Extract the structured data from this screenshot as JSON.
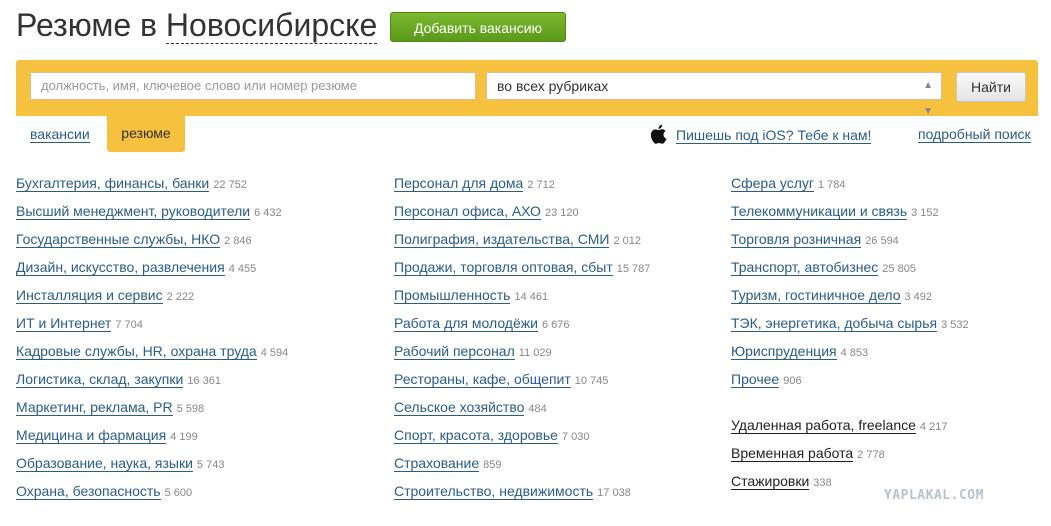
{
  "header": {
    "title_prefix": "Резюме в",
    "city": "Новосибирске",
    "add_button": "Добавить вакансию"
  },
  "search": {
    "placeholder": "должность, имя, ключевое слово или номер резюме",
    "rubric_value": "во всех рубриках",
    "find_button": "Найти"
  },
  "tabs": {
    "vacancies": "вакансии",
    "resumes": "резюме"
  },
  "links": {
    "ios": "Пишешь под iOS? Тебе к нам!",
    "advanced": "подробный поиск"
  },
  "categories": [
    [
      {
        "name": "Бухгалтерия, финансы, банки",
        "count": "22 752"
      },
      {
        "name": "Высший менеджмент, руководители",
        "count": "6 432"
      },
      {
        "name": "Государственные службы, НКО",
        "count": "2 846"
      },
      {
        "name": "Дизайн, искусство, развлечения",
        "count": "4 455"
      },
      {
        "name": "Инсталляция и сервис",
        "count": "2 222"
      },
      {
        "name": "ИТ и Интернет",
        "count": "7 704"
      },
      {
        "name": "Кадровые службы, HR, охрана труда",
        "count": "4 594"
      },
      {
        "name": "Логистика, склад, закупки",
        "count": "16 361"
      },
      {
        "name": "Маркетинг, реклама, PR",
        "count": "5 598"
      },
      {
        "name": "Медицина и фармация",
        "count": "4 199"
      },
      {
        "name": "Образование, наука, языки",
        "count": "5 743"
      },
      {
        "name": "Охрана, безопасность",
        "count": "5 600"
      }
    ],
    [
      {
        "name": "Персонал для дома",
        "count": "2 712"
      },
      {
        "name": "Персонал офиса, АХО",
        "count": "23 120"
      },
      {
        "name": "Полиграфия, издательства, СМИ",
        "count": "2 012"
      },
      {
        "name": "Продажи, торговля оптовая, сбыт",
        "count": "15 787"
      },
      {
        "name": "Промышленность",
        "count": "14 461"
      },
      {
        "name": "Работа для молодёжи",
        "count": "6 676"
      },
      {
        "name": "Рабочий персонал",
        "count": "11 029"
      },
      {
        "name": "Рестораны, кафе, общепит",
        "count": "10 745"
      },
      {
        "name": "Сельское хозяйство",
        "count": "484"
      },
      {
        "name": "Спорт, красота, здоровье",
        "count": "7 030"
      },
      {
        "name": "Страхование",
        "count": "859"
      },
      {
        "name": "Строительство, недвижимость",
        "count": "17 038"
      }
    ],
    [
      {
        "name": "Сфера услуг",
        "count": "1 784"
      },
      {
        "name": "Телекоммуникации и связь",
        "count": "3 152"
      },
      {
        "name": "Торговля розничная",
        "count": "26 594"
      },
      {
        "name": "Транспорт, автобизнес",
        "count": "25 805"
      },
      {
        "name": "Туризм, гостиничное дело",
        "count": "3 492"
      },
      {
        "name": "ТЭК, энергетика, добыча сырья",
        "count": "3 532"
      },
      {
        "name": "Юриспруденция",
        "count": "4 853"
      },
      {
        "name": "Прочее",
        "count": "906"
      }
    ]
  ],
  "extra": [
    {
      "name": "Удаленная работа, freelance",
      "count": "4 217"
    },
    {
      "name": "Временная работа",
      "count": "2 778"
    },
    {
      "name": "Стажировки",
      "count": "338"
    }
  ],
  "watermark": "YAPLAKAL.COM",
  "colors": {
    "accent_yellow": "#f5c13f",
    "add_button_green": "#6aaa24",
    "link_blue": "#2a5d8a"
  }
}
